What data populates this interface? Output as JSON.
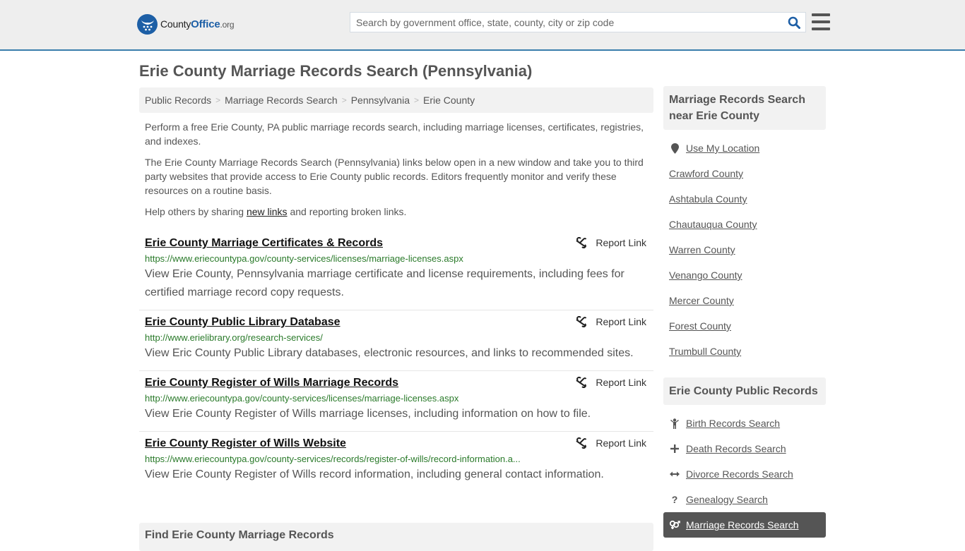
{
  "header": {
    "logo": {
      "part1": "County",
      "part2": "Office",
      "part3": ".org"
    },
    "search_placeholder": "Search by government office, state, county, city or zip code",
    "search_value": ""
  },
  "page_title": "Erie County Marriage Records Search (Pennsylvania)",
  "breadcrumb": [
    "Public Records",
    "Marriage Records Search",
    "Pennsylvania",
    "Erie County"
  ],
  "breadcrumb_separator": ">",
  "intro": {
    "p1": "Perform a free Erie County, PA public marriage records search, including marriage licenses, certificates, registries, and indexes.",
    "p2": "The Erie County Marriage Records Search (Pennsylvania) links below open in a new window and take you to third party websites that provide access to Erie County public records. Editors frequently monitor and verify these resources on a routine basis.",
    "p3_before": "Help others by sharing ",
    "p3_link": "new links",
    "p3_after": " and reporting broken links."
  },
  "report_label": "Report Link",
  "records": [
    {
      "title": "Erie County Marriage Certificates & Records",
      "url": "https://www.eriecountypa.gov/county-services/licenses/marriage-licenses.aspx",
      "desc": "View Erie County, Pennsylvania marriage certificate and license requirements, including fees for certified marriage record copy requests."
    },
    {
      "title": "Erie County Public Library Database",
      "url": "http://www.erielibrary.org/research-services/",
      "desc": "View Eric County Public Library databases, electronic resources, and links to recommended sites."
    },
    {
      "title": "Erie County Register of Wills Marriage Records",
      "url": "http://www.eriecountypa.gov/county-services/licenses/marriage-licenses.aspx",
      "desc": "View Erie County Register of Wills marriage licenses, including information on how to file."
    },
    {
      "title": "Erie County Register of Wills Website",
      "url": "https://www.eriecountypa.gov/county-services/records/register-of-wills/record-information.a...",
      "desc": "View Erie County Register of Wills record information, including general contact information."
    }
  ],
  "find_heading": "Find Erie County Marriage Records",
  "sidebar_nearby": {
    "heading": "Marriage Records Search near Erie County",
    "use_location": "Use My Location",
    "counties": [
      "Crawford County",
      "Ashtabula County",
      "Chautauqua County",
      "Warren County",
      "Venango County",
      "Mercer County",
      "Forest County",
      "Trumbull County"
    ]
  },
  "sidebar_public": {
    "heading": "Erie County Public Records",
    "items": [
      {
        "label": "Birth Records Search",
        "icon": "child-icon",
        "active": false
      },
      {
        "label": "Death Records Search",
        "icon": "plus-icon",
        "active": false
      },
      {
        "label": "Divorce Records Search",
        "icon": "arrows-horizontal-icon",
        "active": false
      },
      {
        "label": "Genealogy Search",
        "icon": "question-icon",
        "active": false
      },
      {
        "label": "Marriage Records Search",
        "icon": "venus-mars-icon",
        "active": true
      }
    ]
  },
  "colors": {
    "brand_blue": "#1d5fa6",
    "header_border": "#3a7eac",
    "url_green": "#2a7a2a",
    "active_bg": "#555555"
  }
}
